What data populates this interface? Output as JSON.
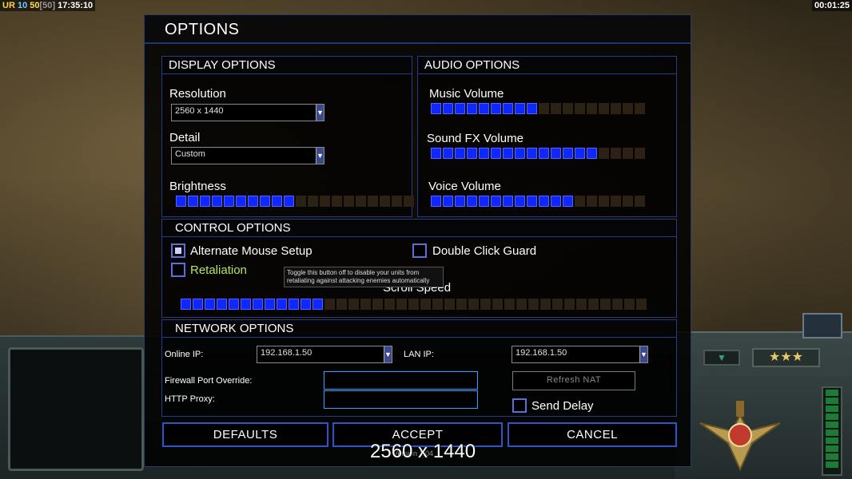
{
  "hud": {
    "ur": "UR",
    "ten": "10",
    "fifty": "50",
    "fifty_bracket": "[50]",
    "clock": "17:35:10",
    "elapsed": "00:01:25",
    "stars": "★★★",
    "chevron": "▼"
  },
  "dialog": {
    "title": "OPTIONS",
    "display": {
      "header": "DISPLAY OPTIONS",
      "resolution_label": "Resolution",
      "resolution_value": "2560 x 1440",
      "detail_label": "Detail",
      "detail_value": "Custom",
      "brightness_label": "Brightness",
      "brightness_level": 0.5
    },
    "audio": {
      "header": "AUDIO OPTIONS",
      "music_label": "Music Volume",
      "music_level": 0.5,
      "sfx_label": "Sound FX Volume",
      "sfx_level": 0.75,
      "voice_label": "Voice Volume",
      "voice_level": 0.65
    },
    "control": {
      "header": "CONTROL OPTIONS",
      "alt_mouse_label": "Alternate Mouse Setup",
      "alt_mouse_checked": true,
      "double_click_label": "Double Click Guard",
      "double_click_checked": false,
      "retaliation_label": "Retaliation",
      "retaliation_checked": false,
      "tooltip": "Toggle this button off to disable your units from retaliating against attacking enemies automatically",
      "scroll_label": "Scroll Speed",
      "scroll_level": 0.3
    },
    "network": {
      "header": "NETWORK OPTIONS",
      "online_ip_label": "Online IP:",
      "online_ip_value": "192.168.1.50",
      "lan_ip_label": "LAN IP:",
      "lan_ip_value": "192.168.1.50",
      "firewall_label": "Firewall Port Override:",
      "http_proxy_label": "HTTP Proxy:",
      "refresh_nat_label": "Refresh NAT",
      "send_delay_label": "Send Delay",
      "send_delay_checked": false
    },
    "buttons": {
      "defaults": "DEFAULTS",
      "accept": "ACCEPT",
      "cancel": "CANCEL"
    },
    "resolution_overlay": "2560 x 1440",
    "version": "Version 1.04"
  },
  "colors": {
    "accent_blue": "#0e28ff",
    "retaliation_green": "#b8e65a"
  }
}
